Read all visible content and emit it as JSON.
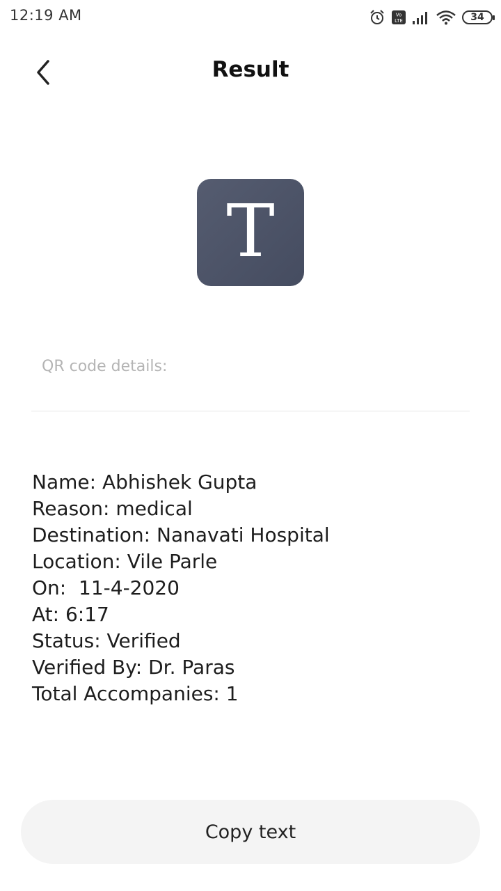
{
  "status_bar": {
    "time": "12:19 AM",
    "icons": [
      "alarm-icon",
      "volte-icon",
      "signal-icon",
      "wifi-icon",
      "battery-icon"
    ],
    "volte_label": "Vo LTE",
    "battery_level": "34"
  },
  "header": {
    "back_icon": "chevron-left-icon",
    "title": "Result"
  },
  "app_icon": {
    "letter": "T",
    "color": "#4b5166"
  },
  "details_label": "QR code details:",
  "details_lines": [
    "Name: Abhishek Gupta",
    "Reason: medical",
    "Destination: Nanavati Hospital",
    "Location: Vile Parle",
    "On:  11-4-2020",
    "At: 6:17",
    "Status: Verified",
    "Verified By: Dr. Paras",
    "Total Accompanies: 1"
  ],
  "copy_button": {
    "label": "Copy text"
  }
}
